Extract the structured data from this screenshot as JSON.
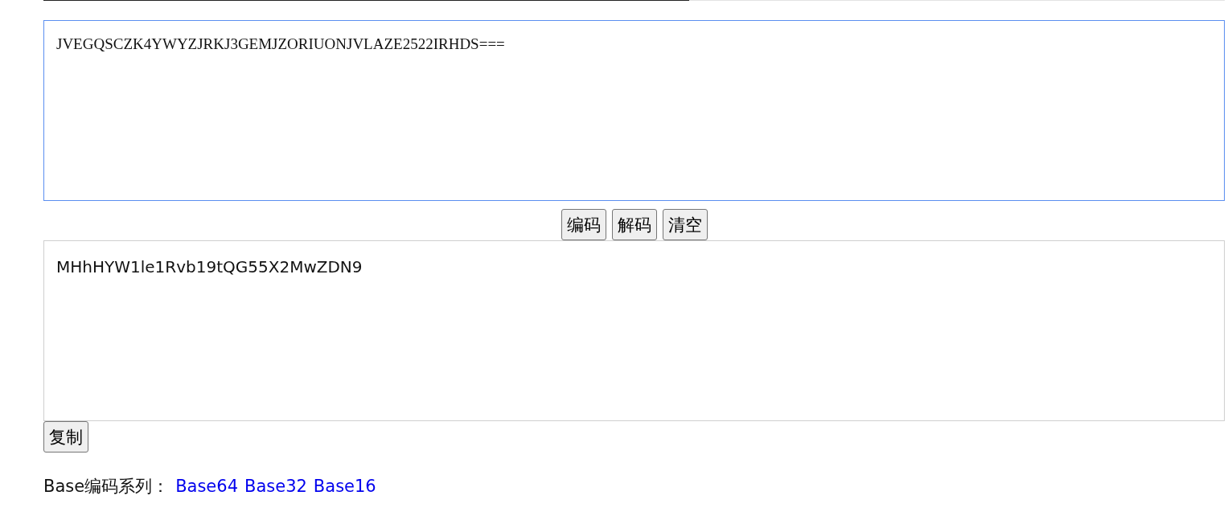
{
  "input": {
    "value": "JVEGQSCZK4YWYZJRKJ3GEMJZORIUONJVLAZE2522IRHDS===",
    "focused": true
  },
  "actions": [
    {
      "label": "编码"
    },
    {
      "label": "解码"
    },
    {
      "label": "清空"
    }
  ],
  "output": {
    "value": "MHhHYW1le1Rvb19tQG55X2MwZDN9"
  },
  "copy_button": {
    "label": "复制"
  },
  "footer": {
    "label": "Base编码系列：",
    "links": [
      "Base64",
      "Base32",
      "Base16"
    ]
  }
}
